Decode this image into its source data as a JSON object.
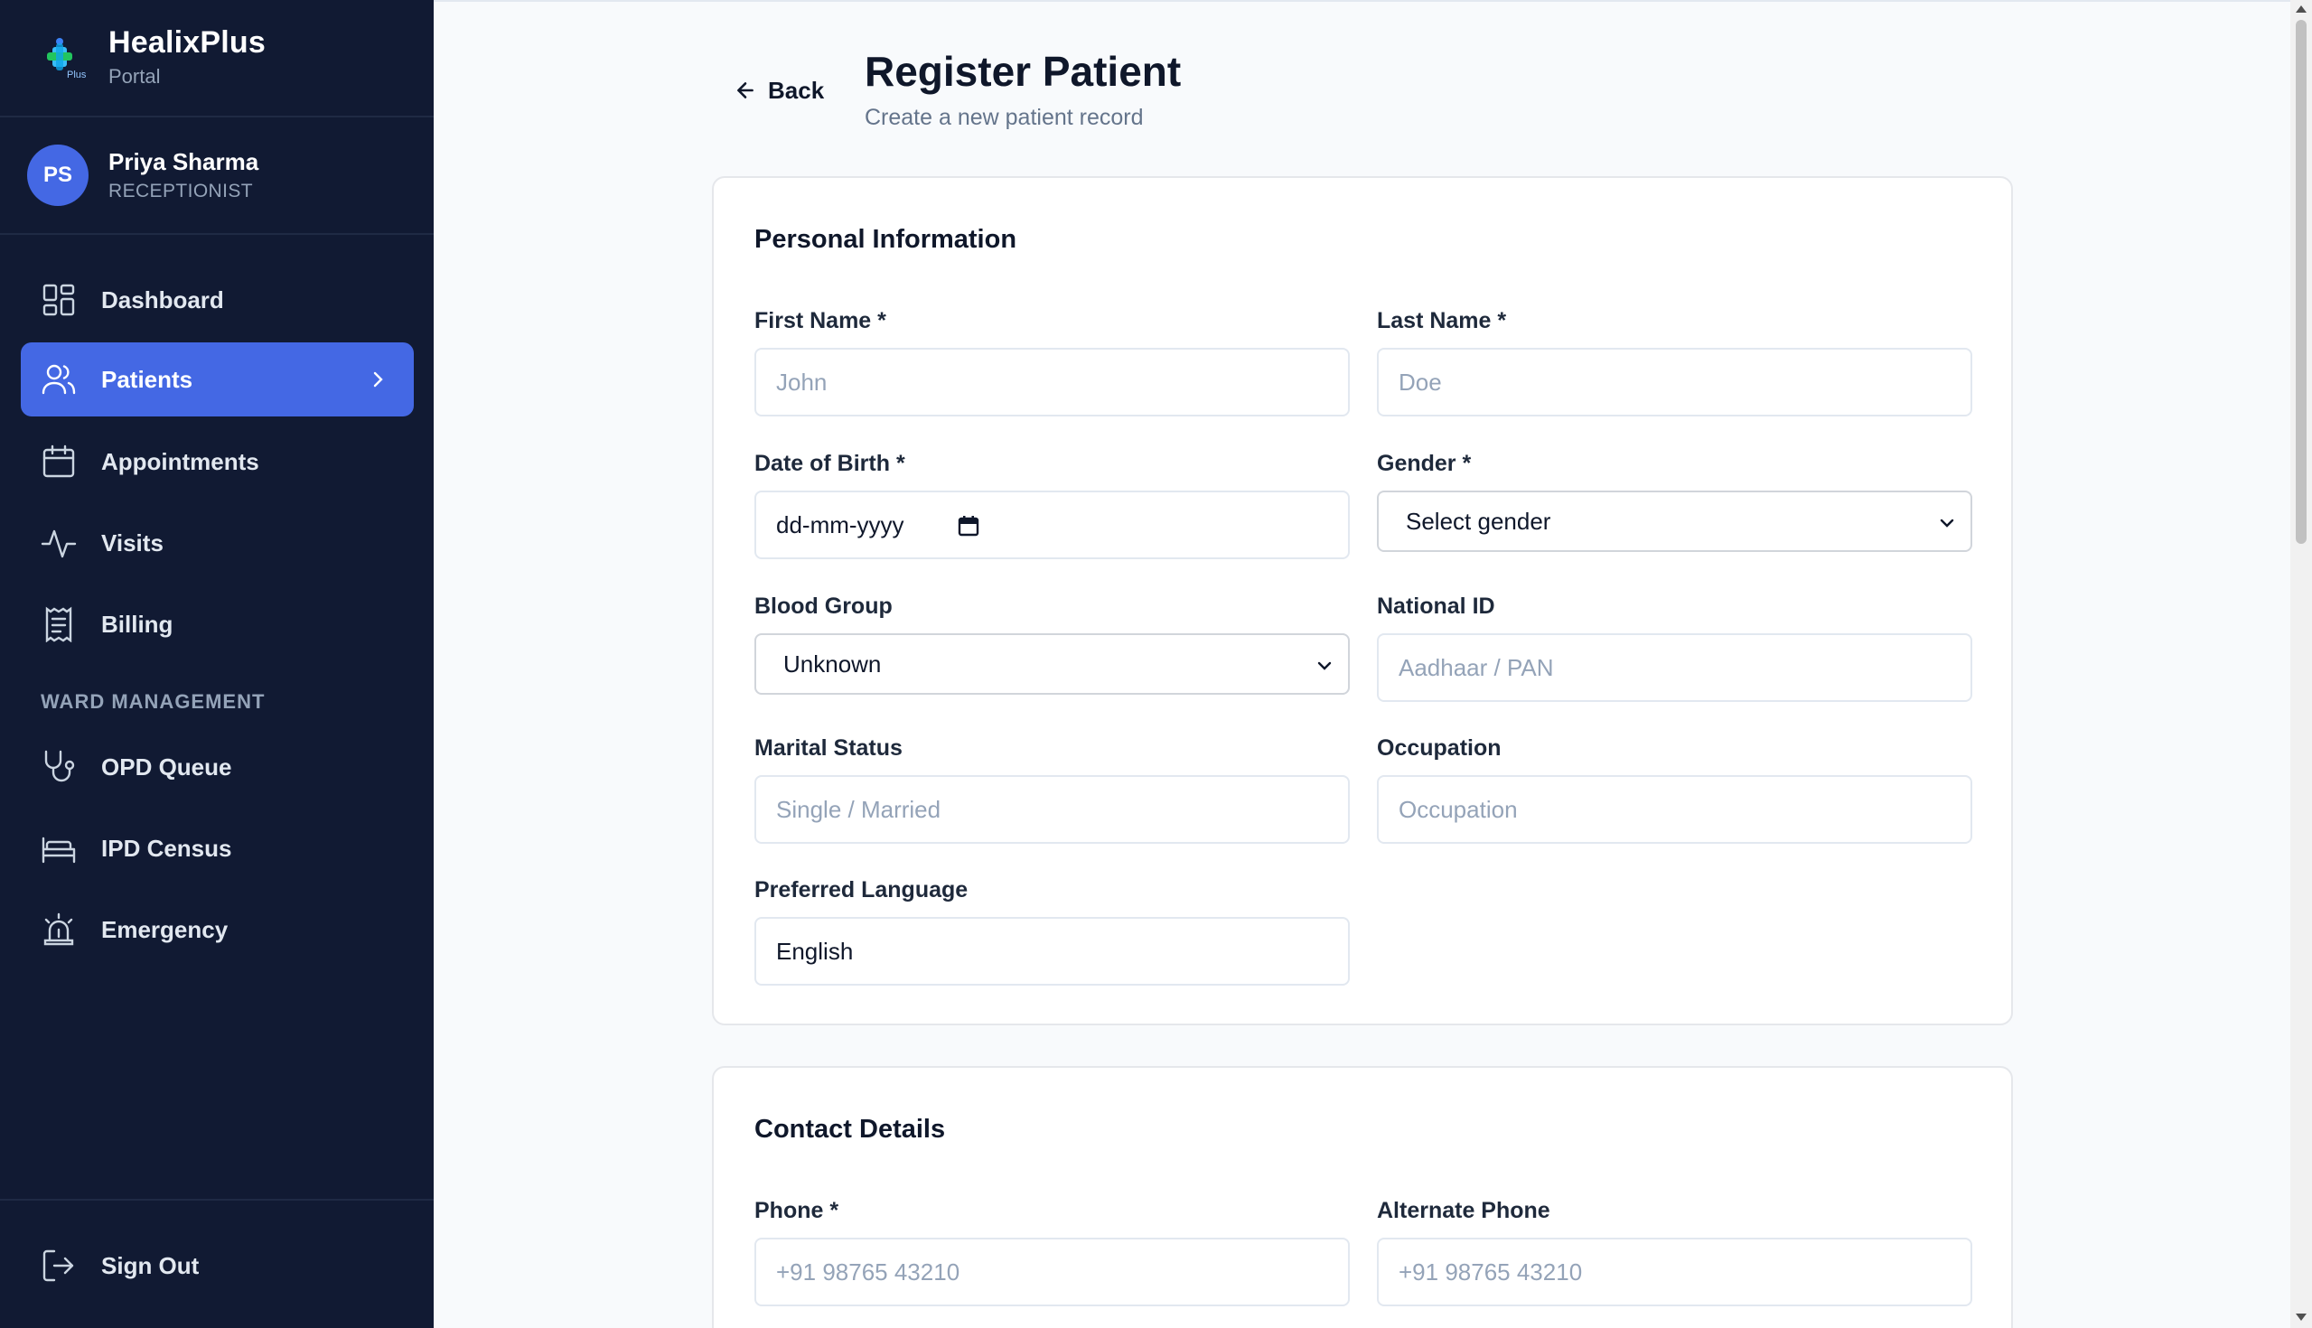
{
  "brand": {
    "name": "HealixPlus",
    "subtitle": "Portal",
    "logo_text": "Plus"
  },
  "user": {
    "initials": "PS",
    "name": "Priya Sharma",
    "role": "RECEPTIONIST"
  },
  "nav": {
    "items": [
      {
        "label": "Dashboard",
        "icon": "dashboard-icon"
      },
      {
        "label": "Patients",
        "icon": "users-icon",
        "active": true
      },
      {
        "label": "Appointments",
        "icon": "calendar-icon"
      },
      {
        "label": "Visits",
        "icon": "activity-icon"
      },
      {
        "label": "Billing",
        "icon": "receipt-icon"
      }
    ],
    "section_title": "WARD MANAGEMENT",
    "ward_items": [
      {
        "label": "OPD Queue",
        "icon": "stethoscope-icon"
      },
      {
        "label": "IPD Census",
        "icon": "bed-icon"
      },
      {
        "label": "Emergency",
        "icon": "siren-icon"
      }
    ],
    "signout": "Sign Out"
  },
  "header": {
    "back_label": "Back",
    "title": "Register Patient",
    "subtitle": "Create a new patient record"
  },
  "personal": {
    "title": "Personal Information",
    "first_name": {
      "label": "First Name *",
      "placeholder": "John"
    },
    "last_name": {
      "label": "Last Name *",
      "placeholder": "Doe"
    },
    "dob": {
      "label": "Date of Birth *",
      "placeholder": "dd-mm-yyyy"
    },
    "gender": {
      "label": "Gender *",
      "value": "Select gender"
    },
    "blood_group": {
      "label": "Blood Group",
      "value": "Unknown"
    },
    "national_id": {
      "label": "National ID",
      "placeholder": "Aadhaar / PAN"
    },
    "marital_status": {
      "label": "Marital Status",
      "placeholder": "Single / Married"
    },
    "occupation": {
      "label": "Occupation",
      "placeholder": "Occupation"
    },
    "preferred_language": {
      "label": "Preferred Language",
      "value": "English"
    }
  },
  "contact": {
    "title": "Contact Details",
    "phone": {
      "label": "Phone *",
      "placeholder": "+91 98765 43210"
    },
    "alt_phone": {
      "label": "Alternate Phone",
      "placeholder": "+91 98765 43210"
    }
  },
  "colors": {
    "sidebar_bg": "#111a33",
    "accent": "#4468e4",
    "page_bg": "#f8fafc"
  }
}
